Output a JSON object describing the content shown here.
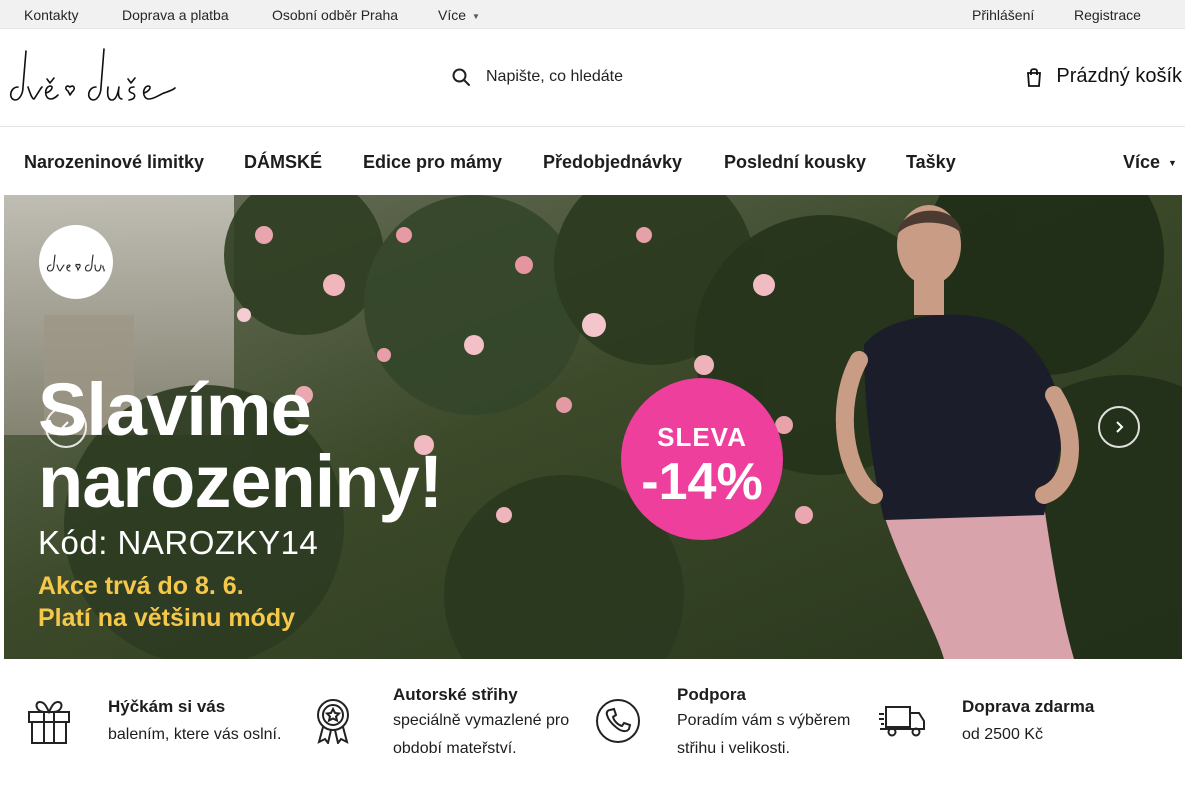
{
  "topbar": {
    "links": [
      "Kontakty",
      "Doprava a platba",
      "Osobní odběr Praha"
    ],
    "more_label": "Více",
    "login": "Přihlášení",
    "register": "Registrace"
  },
  "header": {
    "logo_text": "dvě v duše",
    "search_placeholder": "Napište, co hledáte",
    "cart_label": "Prázdný košík"
  },
  "nav": {
    "items": [
      "Narozeninové limitky",
      "DÁMSKÉ",
      "Edice pro mámy",
      "Předobjednávky",
      "Poslední kousky",
      "Tašky"
    ],
    "more_label": "Více"
  },
  "hero": {
    "logo_text": "dvě v duše",
    "headline_1": "Slavíme",
    "headline_2": "narozeniny!",
    "code_line": "Kód: NAROZKY14",
    "promo_1": "Akce trvá do 8. 6.",
    "promo_2": "Platí na většinu módy",
    "badge_top": "SLEVA",
    "badge_value": "-14%"
  },
  "benefits": [
    {
      "icon": "gift-icon",
      "title": "Hýčkám si vás",
      "text": "balením, ktere vás oslní."
    },
    {
      "icon": "award-icon",
      "title": "Autorské střihy",
      "text": "speciálně vymazlené pro období mateřství."
    },
    {
      "icon": "phone-icon",
      "title": "Podpora",
      "text": "Poradím vám s výběrem střihu i velikosti."
    },
    {
      "icon": "truck-icon",
      "title": "Doprava zdarma",
      "text": "od 2500 Kč"
    }
  ],
  "colors": {
    "badge_pink": "#ee3f9c",
    "promo_yellow": "#f6c84a",
    "topbar_bg": "#f1f1f1"
  }
}
